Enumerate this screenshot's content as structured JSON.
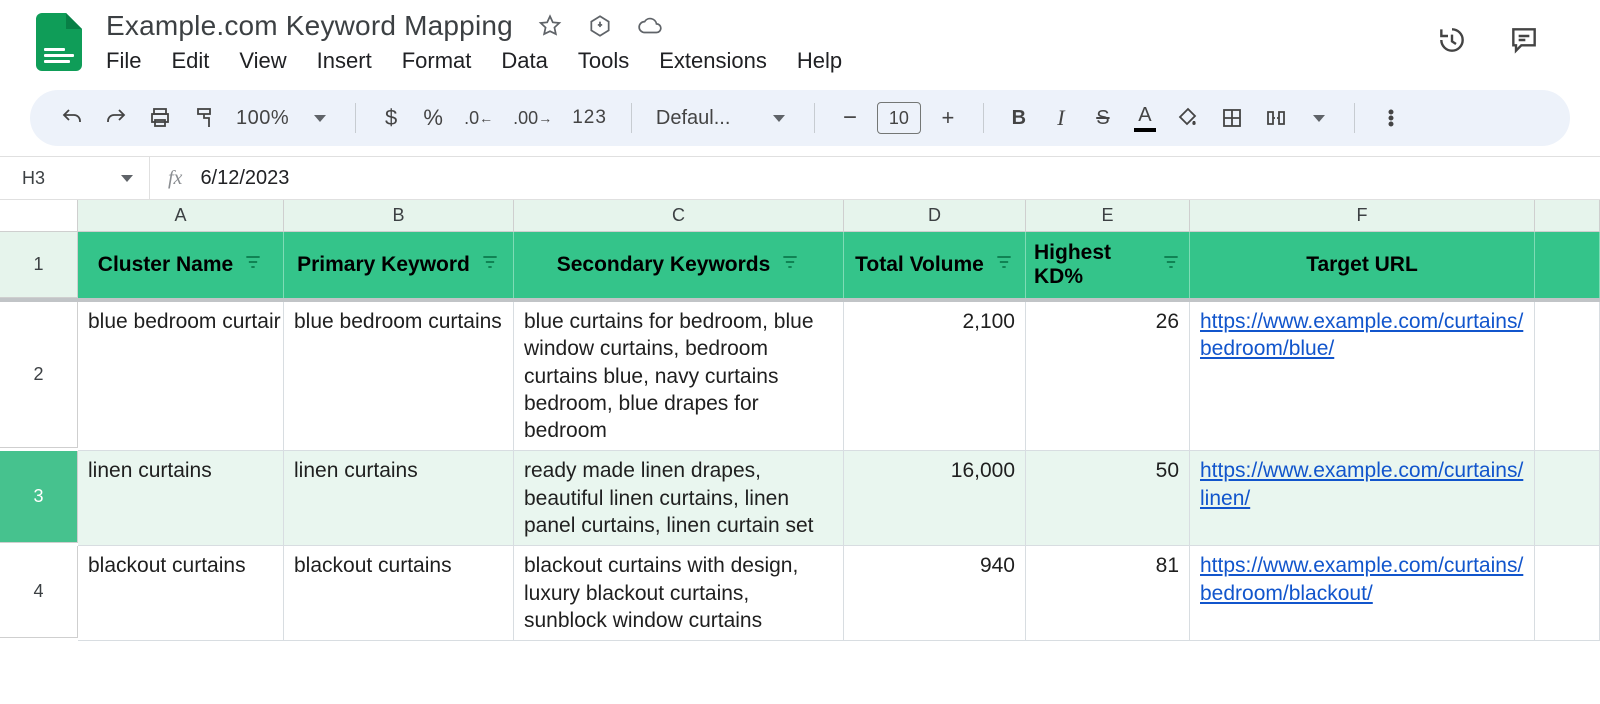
{
  "doc": {
    "title": "Example.com Keyword Mapping"
  },
  "menus": {
    "file": "File",
    "edit": "Edit",
    "view": "View",
    "insert": "Insert",
    "format": "Format",
    "data": "Data",
    "tools": "Tools",
    "extensions": "Extensions",
    "help": "Help"
  },
  "toolbar": {
    "zoom": "100%",
    "currency": "$",
    "percent": "%",
    "dec_dec": ".0",
    "dec_inc": ".00",
    "num_fmt": "123",
    "font": "Defaul...",
    "font_size": "10",
    "bold": "B",
    "italic": "I",
    "strike": "S",
    "text_color": "A"
  },
  "namebox": {
    "ref": "H3",
    "formula": "6/12/2023"
  },
  "columns": {
    "A": "A",
    "B": "B",
    "C": "C",
    "D": "D",
    "E": "E",
    "F": "F"
  },
  "headers": {
    "cluster": "Cluster Name",
    "primary": "Primary Keyword",
    "secondary": "Secondary Keywords",
    "volume": "Total Volume",
    "kd": "Highest KD%",
    "url": "Target URL"
  },
  "rows": {
    "r1": "1",
    "r2": "2",
    "r3": "3",
    "r4": "4"
  },
  "data": {
    "r2": {
      "cluster": "blue bedroom curtair",
      "primary": "blue bedroom curtains",
      "secondary": "blue curtains for bedroom, blue window curtains, bedroom curtains blue, navy curtains bedroom, blue drapes for bedroom",
      "volume": "2,100",
      "kd": "26",
      "url_a": "https://www.example.com/curtains/",
      "url_b": "bedroom/blue/"
    },
    "r3": {
      "cluster": "linen curtains",
      "primary": "linen curtains",
      "secondary": "ready made linen drapes, beautiful linen curtains, linen panel curtains, linen curtain set",
      "volume": "16,000",
      "kd": "50",
      "url_a": "https://www.example.com/curtains/",
      "url_b": "linen/"
    },
    "r4": {
      "cluster": "blackout curtains",
      "primary": "blackout curtains",
      "secondary": "blackout curtains with design, luxury blackout curtains, sunblock window curtains",
      "volume": "940",
      "kd": "81",
      "url_a": "https://www.example.com/curtains/",
      "url_b": "bedroom/blackout/"
    }
  }
}
